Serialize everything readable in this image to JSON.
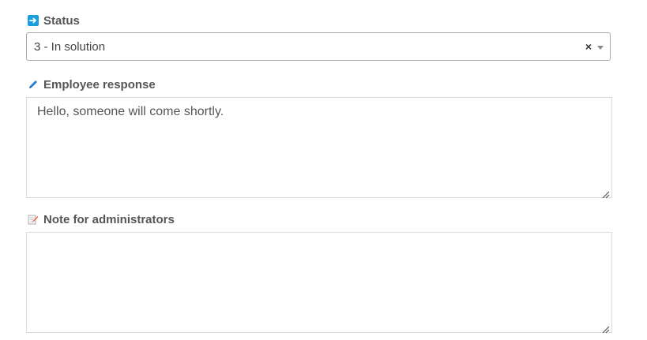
{
  "status": {
    "label": "Status",
    "icon": "arrow-right-icon",
    "selected_value": "3 - In solution",
    "clear_glyph": "×"
  },
  "employee_response": {
    "label": "Employee response",
    "icon": "pencil-icon",
    "value": "Hello, someone will come shortly."
  },
  "admin_note": {
    "label": "Note for administrators",
    "icon": "note-edit-icon",
    "value": ""
  },
  "colors": {
    "status_icon_bg": "#1a9ee0",
    "pencil_icon": "#2a7fd4",
    "note_icon_pen": "#e8643a"
  }
}
